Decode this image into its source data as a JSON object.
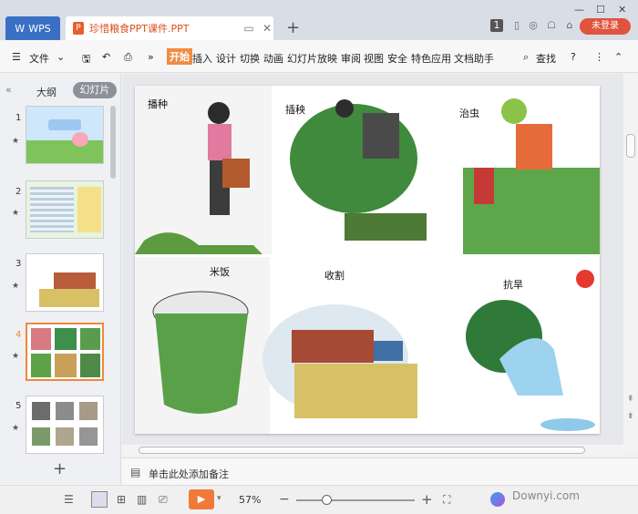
{
  "titlebar": {
    "wps_label": "WPS",
    "doc_tab_label": "珍惜粮食PPT课件.PPT",
    "login_label": "未登录",
    "badge_label": "1"
  },
  "ribbon": {
    "file_label": "文件",
    "menus": [
      "开始",
      "插入",
      "设计",
      "切换",
      "动画",
      "幻灯片放映",
      "审阅",
      "视图",
      "安全",
      "特色应用",
      "文档助手"
    ],
    "search_label": "查找"
  },
  "left_panel": {
    "tab_outline": "大纲",
    "tab_slides": "幻灯片",
    "thumb_numbers": [
      "1",
      "2",
      "3",
      "4",
      "5"
    ],
    "selected_index": 4
  },
  "slide": {
    "labels": [
      "播种",
      "插秧",
      "治虫",
      "米饭",
      "收割",
      "抗旱"
    ]
  },
  "notes": {
    "placeholder": "单击此处添加备注"
  },
  "status": {
    "zoom": "57%",
    "watermark": "Downyi.com"
  },
  "colors": {
    "accent": "#f07a3a",
    "tab_blue": "#3a6fc4",
    "login_red": "#e0533d"
  }
}
